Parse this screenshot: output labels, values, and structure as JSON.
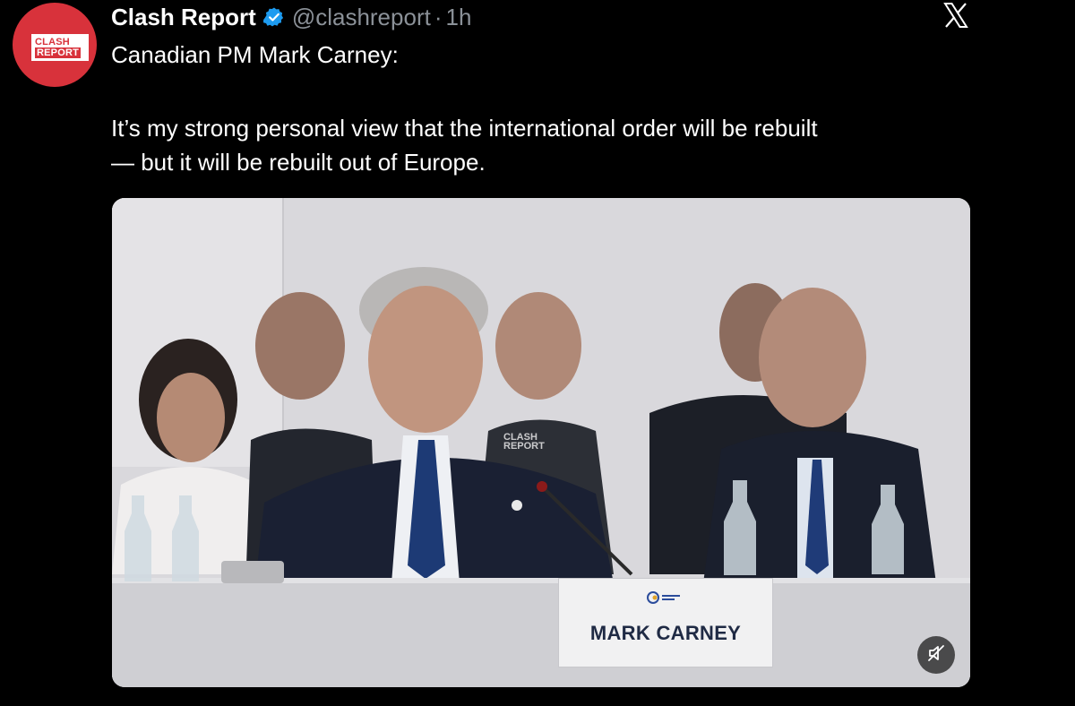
{
  "post": {
    "author_name": "Clash Report",
    "handle": "@clashreport",
    "separator": "·",
    "time": "1h",
    "avatar_text_top": "CLASH",
    "avatar_text_bottom": "REPORT",
    "text_line1": "Canadian PM Mark Carney:",
    "text_quote_line1": "It’s my strong personal view that the international order will be rebuilt",
    "text_quote_line2": "— but it will be rebuilt out of Europe."
  },
  "media": {
    "nameplate": "MARK CARNEY",
    "watermark_top": "CLASH",
    "watermark_bottom": "REPORT",
    "muted": true
  },
  "icons": {
    "verified": "verified-badge-icon",
    "platform": "x-logo-icon",
    "mute": "speaker-muted-icon"
  },
  "colors": {
    "background": "#000000",
    "verified": "#1d9bf0",
    "brand_red": "#d8323b",
    "secondary_text": "#8b9198"
  }
}
